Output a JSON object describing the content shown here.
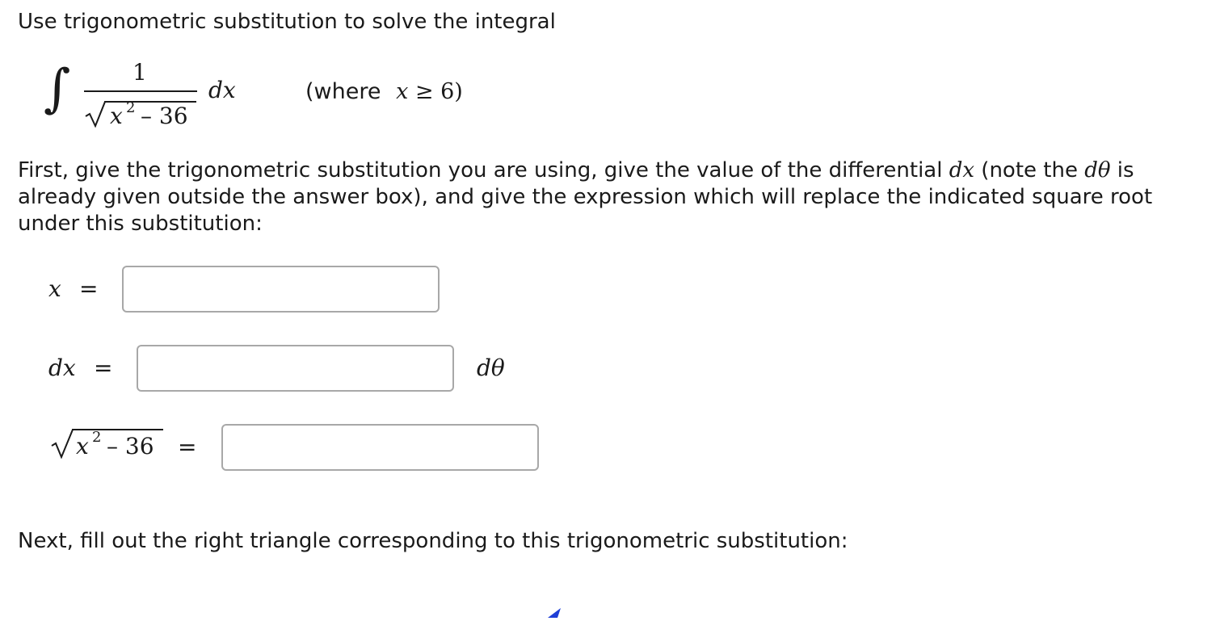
{
  "instruction_title": "Use trigonometric substitution to solve the integral",
  "integral": {
    "sign": "∫",
    "numerator": "1",
    "radicand_var": "x",
    "radicand_exp": "2",
    "radicand_rest": "– 36",
    "differential": "dx",
    "condition_open": "(where",
    "condition_expr": "x",
    "condition_op": "≥ 6)"
  },
  "paragraph": {
    "line1_a": "First, give the trigonometric substitution you are using, give the value of the differential ",
    "line1_dx": "dx",
    "line1_b": " (note the ",
    "line1_dtheta": "dθ",
    "line1_c": " is",
    "line2": "already given outside the answer box), and give the expression which will replace the indicated square root",
    "line3": "under this substitution:"
  },
  "answers": {
    "x_label": "x",
    "dx_label": "dx",
    "equals": "=",
    "dtheta_suffix": "dθ",
    "sqrt_var": "x",
    "sqrt_exp": "2",
    "sqrt_rest": "– 36",
    "x_value": "",
    "dx_value": "",
    "sqrt_value": ""
  },
  "next_text": "Next, fill out the right triangle corresponding to this trigonometric substitution:",
  "colors": {
    "box_border": "#a8a8a8",
    "arrow": "#1f3fd6"
  }
}
